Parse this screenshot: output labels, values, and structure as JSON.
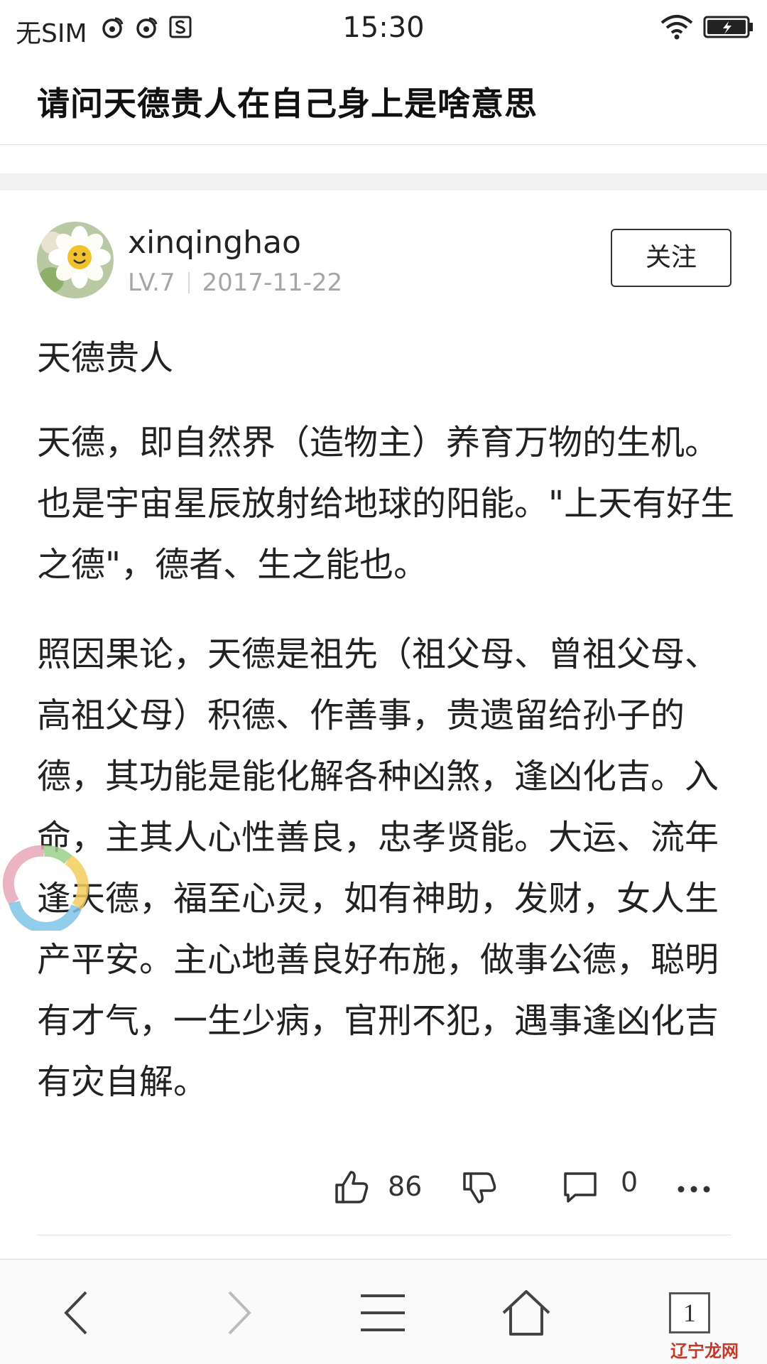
{
  "status_bar": {
    "carrier": "无SIM",
    "time": "15:30",
    "icons": [
      "weibo-icon",
      "weibo-icon",
      "s-app-icon",
      "wifi-icon",
      "battery-charging-icon"
    ]
  },
  "header": {
    "title": "请问天德贵人在自己身上是啥意思"
  },
  "answer": {
    "author": {
      "username": "xinqinghao",
      "level": "LV.7",
      "date": "2017-11-22",
      "follow_label": "关注"
    },
    "heading": "天德贵人",
    "paragraphs": [
      "天德，即自然界（造物主）养育万物的生机。也是宇宙星辰放射给地球的阳能。\"上天有好生之德\"，德者、生之能也。",
      "照因果论，天德是祖先（祖父母、曾祖父母、高祖父母）积德、作善事，贵遗留给孙子的德，其功能是能化解各种凶煞，逢凶化吉。入命，主其人心性善良，忠孝贤能。大运、流年逢天德，福至心灵，如有神助，发财，女人生产平安。主心地善良好布施，做事公德，聪明有才气，一生少病，官刑不犯，遇事逢凶化吉有灾自解。"
    ],
    "actions": {
      "like_count": "86",
      "comment_count": "0"
    }
  },
  "bottom_nav": {
    "tab_count": "1",
    "items": [
      "back-icon",
      "forward-icon",
      "menu-icon",
      "home-icon",
      "tabs-icon"
    ]
  },
  "watermark": "辽宁龙网"
}
